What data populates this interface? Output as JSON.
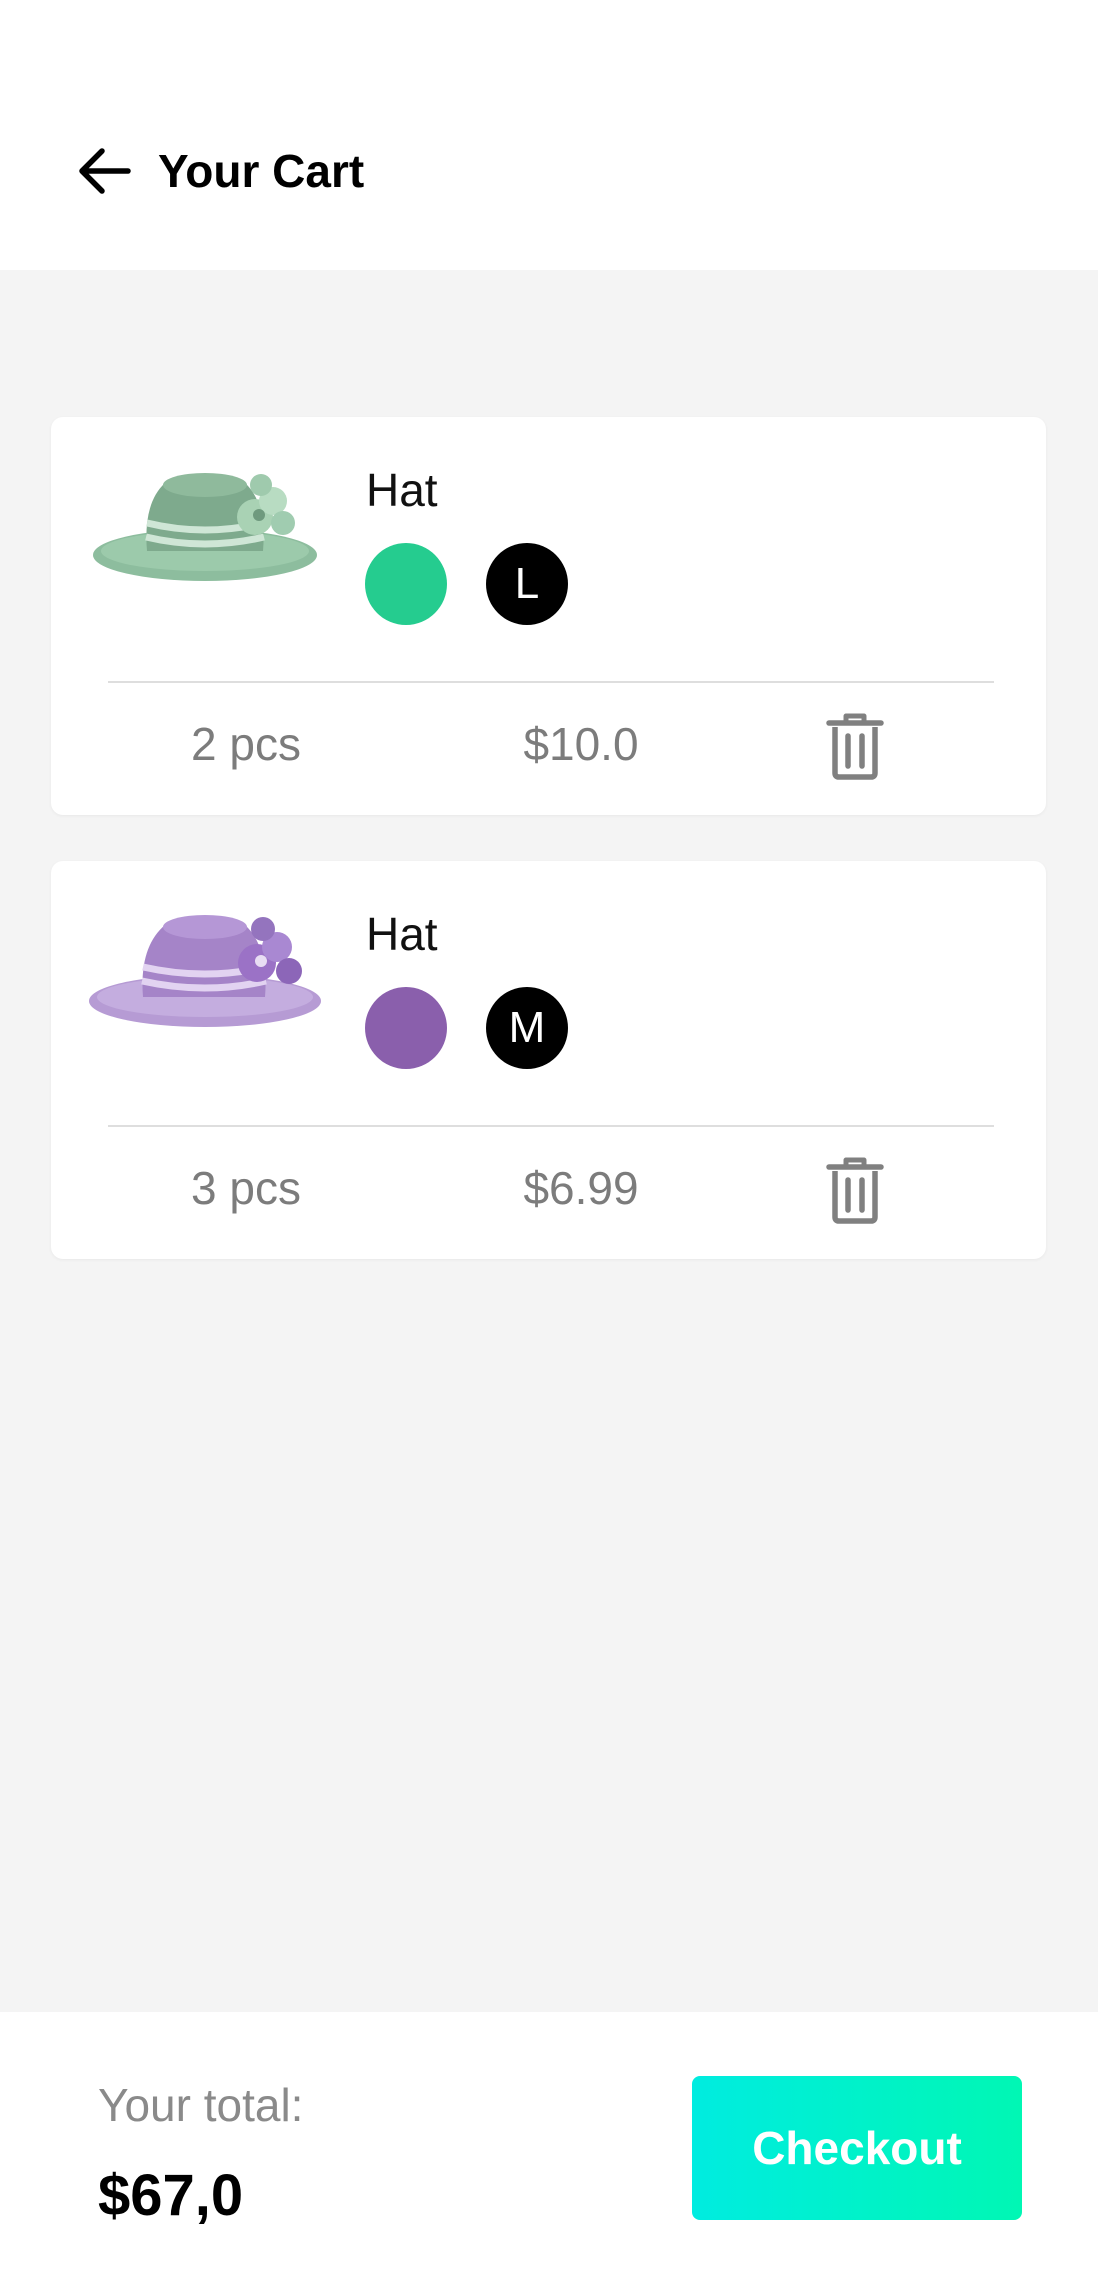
{
  "header": {
    "title": "Your Cart",
    "back_icon": "arrow-left-icon"
  },
  "colors": {
    "green_swatch": "#25cc8f",
    "purple_swatch": "#8a5fac",
    "checkout_gradient_start": "#00ece0",
    "checkout_gradient_end": "#00f7b4"
  },
  "cart": {
    "items": [
      {
        "name": "Hat",
        "color": "#25cc8f",
        "size": "L",
        "quantity": "2 pcs",
        "price": "$10.0",
        "delete_icon": "trash-icon"
      },
      {
        "name": "Hat",
        "color": "#8a5fac",
        "size": "M",
        "quantity": "3 pcs",
        "price": "$6.99",
        "delete_icon": "trash-icon"
      }
    ]
  },
  "footer": {
    "total_label": "Your total:",
    "total_value": "$67,0",
    "checkout_label": "Checkout"
  }
}
